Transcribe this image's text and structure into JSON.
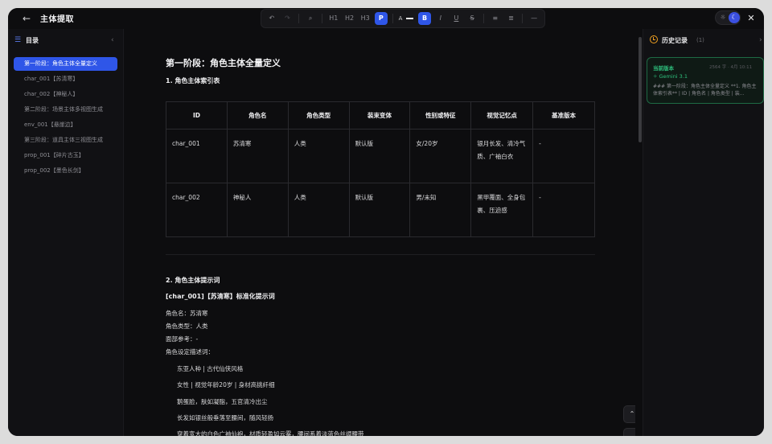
{
  "app": {
    "title": "主体提取"
  },
  "toolbar": {
    "h1": "H1",
    "h2": "H2",
    "h3": "H3",
    "p": "P",
    "text_color": "A",
    "bold": "B",
    "italic": "I",
    "underline": "U",
    "strike": "S",
    "bullet_list": "≡",
    "ordered_list": "≣",
    "hr": "—"
  },
  "sidebar": {
    "title": "目录",
    "items": [
      {
        "label": "第一阶段：角色主体全量定义",
        "active": true
      },
      {
        "label": "char_001【苏清寒】"
      },
      {
        "label": "char_002【神秘人】"
      },
      {
        "label": "第二阶段：场景主体多视图生成"
      },
      {
        "label": "env_001【悬崖边】"
      },
      {
        "label": "第三阶段：道具主体三视图生成"
      },
      {
        "label": "prop_001【碎片古玉】"
      },
      {
        "label": "prop_002【墨色长剑】"
      }
    ]
  },
  "document": {
    "h1": "第一阶段：角色主体全量定义",
    "section1": "1. 角色主体索引表",
    "table": {
      "headers": [
        "ID",
        "角色名",
        "角色类型",
        "装束变体",
        "性别或特征",
        "视觉记忆点",
        "基准版本"
      ],
      "rows": [
        [
          "char_001",
          "苏清寒",
          "人类",
          "默认版",
          "女/20岁",
          "银月长发、清冷气质、广袖白衣",
          "-"
        ],
        [
          "char_002",
          "神秘人",
          "人类",
          "默认版",
          "男/未知",
          "黑甲覆面、全身包裹、压迫感",
          "-"
        ]
      ]
    },
    "section2": "2. 角色主体提示词",
    "prompt_title": "[char_001]【苏清寒】标准化提示词",
    "lines": [
      "角色名：苏清寒",
      "角色类型：人类",
      "面部参考：-",
      "角色设定描述词："
    ],
    "desc": [
      "东亚人种 | 古代仙侠风格",
      "女性 | 视觉年龄20岁 | 身材高挑纤细",
      "鹅蛋脸，肤如凝脂，五官清冷出尘",
      "长发如银丝般垂落至腰间，随风轻扬",
      "穿着宽大的白色广袖仙袍，材质轻盈如云雾，腰间系着淡蓝色丝绸腰带"
    ]
  },
  "history": {
    "title": "历史记录",
    "count": "(1)",
    "card": {
      "label": "当前版本",
      "meta": "2564 字 · 4月 10:11",
      "model": "Gemini 3.1",
      "preview": "### 第一阶段：角色主体全量定义 **1. 角色主体索引表** | ID | 角色名 | 角色类型 | 装..."
    }
  },
  "colors": {
    "accent": "#2f56e8",
    "history_green": "#2ec27e",
    "history_icon": "#f0a020"
  }
}
